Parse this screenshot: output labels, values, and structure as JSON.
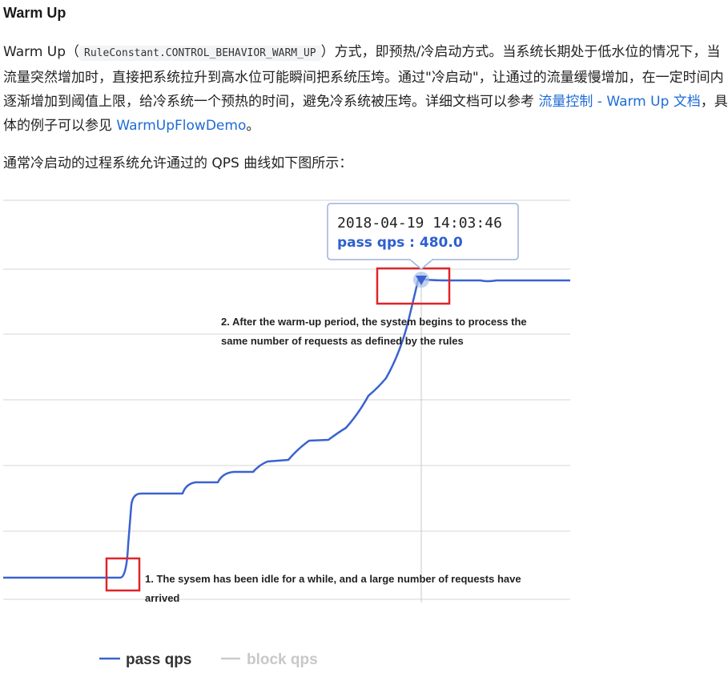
{
  "heading": "Warm Up",
  "intro": {
    "p1_prefix": "Warm Up（",
    "code": "RuleConstant.CONTROL_BEHAVIOR_WARM_UP",
    "p1_mid": "）方式，即预热/冷启动方式。当系统长期处于低水位的情况下，当流量突然增加时，直接把系统拉升到高水位可能瞬间把系统压垮。通过\"冷启动\"，让通过的流量缓慢增加，在一定时间内逐渐增加到阈值上限，给冷系统一个预热的时间，避免冷系统被压垮。详细文档可以参考 ",
    "link1": "流量控制 - Warm Up 文档",
    "p1_after": "，具体的例子可以参见 ",
    "link2": "WarmUpFlowDemo",
    "p1_end": "。",
    "p2": "通常冷启动的过程系统允许通过的 QPS 曲线如下图所示："
  },
  "chart_data": {
    "type": "line",
    "tooltip": {
      "date": "2018-04-19 14:03:46",
      "value": "pass qps : 480.0"
    },
    "annotations": [
      "2. After the warm-up period, the system begins to process the",
      "same number of requests as defined by the rules",
      "1. The sysem has been idle for a while, and a large number of requests have",
      "arrived"
    ],
    "series": [
      {
        "name": "pass qps",
        "color": "#3a62d0"
      },
      {
        "name": "block qps",
        "color": "#cccccc"
      }
    ],
    "grid": true,
    "legend": "bottom"
  },
  "colors": {
    "line": "#3a62d0",
    "highlight_box": "#e0242a",
    "grid": "#e3e3e3",
    "link": "#1e6bd6"
  }
}
